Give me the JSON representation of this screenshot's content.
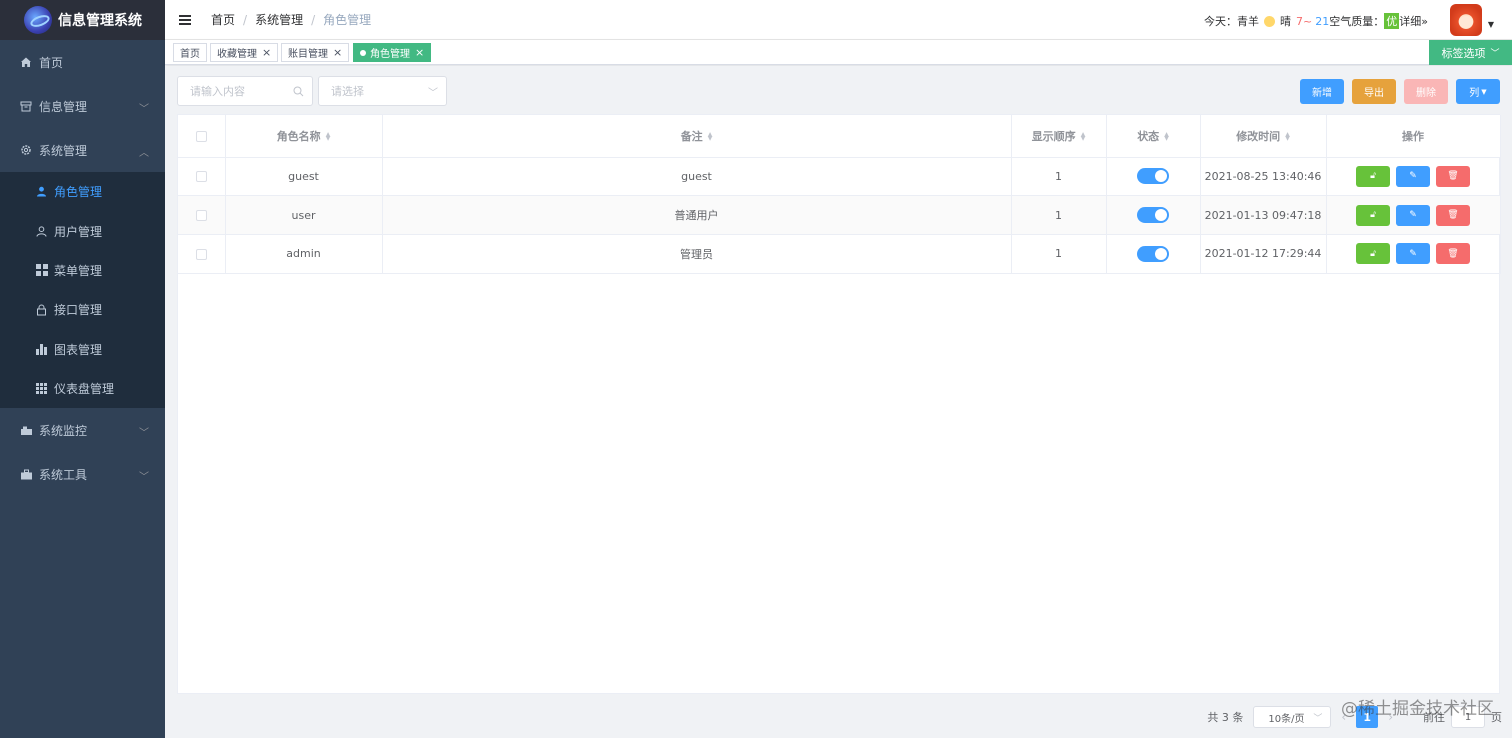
{
  "app": {
    "title": "信息管理系统"
  },
  "sidebar": {
    "items": [
      {
        "label": "首页",
        "icon": "home-icon"
      },
      {
        "label": "信息管理",
        "icon": "archive-icon"
      },
      {
        "label": "系统管理",
        "icon": "gear-icon"
      },
      {
        "label": "系统监控",
        "icon": "monitor-icon"
      },
      {
        "label": "系统工具",
        "icon": "toolbox-icon"
      }
    ],
    "sub_items": [
      {
        "label": "角色管理",
        "icon": "user-solid-icon",
        "active": true
      },
      {
        "label": "用户管理",
        "icon": "user-icon"
      },
      {
        "label": "菜单管理",
        "icon": "menu-grid-icon"
      },
      {
        "label": "接口管理",
        "icon": "lock-icon"
      },
      {
        "label": "图表管理",
        "icon": "bar-chart-icon"
      },
      {
        "label": "仪表盘管理",
        "icon": "dashboard-grid-icon"
      }
    ]
  },
  "header": {
    "breadcrumb": [
      "首页",
      "系统管理",
      "角色管理"
    ],
    "weather": {
      "today_label": "今天：",
      "city": "青羊",
      "condition": "晴",
      "temp_high": "7~",
      "temp_low": "21",
      "air_label": "空气质量：",
      "air_value": "优",
      "detail": "详细»"
    }
  },
  "tags": {
    "items": [
      "首页",
      "收藏管理",
      "账目管理",
      "角色管理"
    ],
    "options_label": "标签选项"
  },
  "toolbar": {
    "search_placeholder": "请输入内容",
    "select_placeholder": "请选择",
    "add_label": "新增",
    "export_label": "导出",
    "delete_label": "删除",
    "columns_label": "列"
  },
  "table": {
    "headers": [
      "角色名称",
      "备注",
      "显示顺序",
      "状态",
      "修改时间",
      "操作"
    ],
    "rows": [
      {
        "name": "guest",
        "remark": "guest",
        "order": "1",
        "enabled": true,
        "modified": "2021-08-25 13:40:46"
      },
      {
        "name": "user",
        "remark": "普通用户",
        "order": "1",
        "enabled": true,
        "modified": "2021-01-13 09:47:18"
      },
      {
        "name": "admin",
        "remark": "管理员",
        "order": "1",
        "enabled": true,
        "modified": "2021-01-12 17:29:44"
      }
    ]
  },
  "pagination": {
    "total_label": "共 3 条",
    "page_size": "10条/页",
    "current_page": "1",
    "goto_prefix": "前往",
    "goto_value": "1",
    "goto_suffix": "页"
  },
  "watermark": "@稀土掘金技术社区",
  "colors": {
    "primary": "#409eff",
    "success": "#67c23a",
    "warning": "#e6a23c",
    "danger": "#f56c6c",
    "sidebar": "#304156",
    "tag_active": "#42b983"
  }
}
